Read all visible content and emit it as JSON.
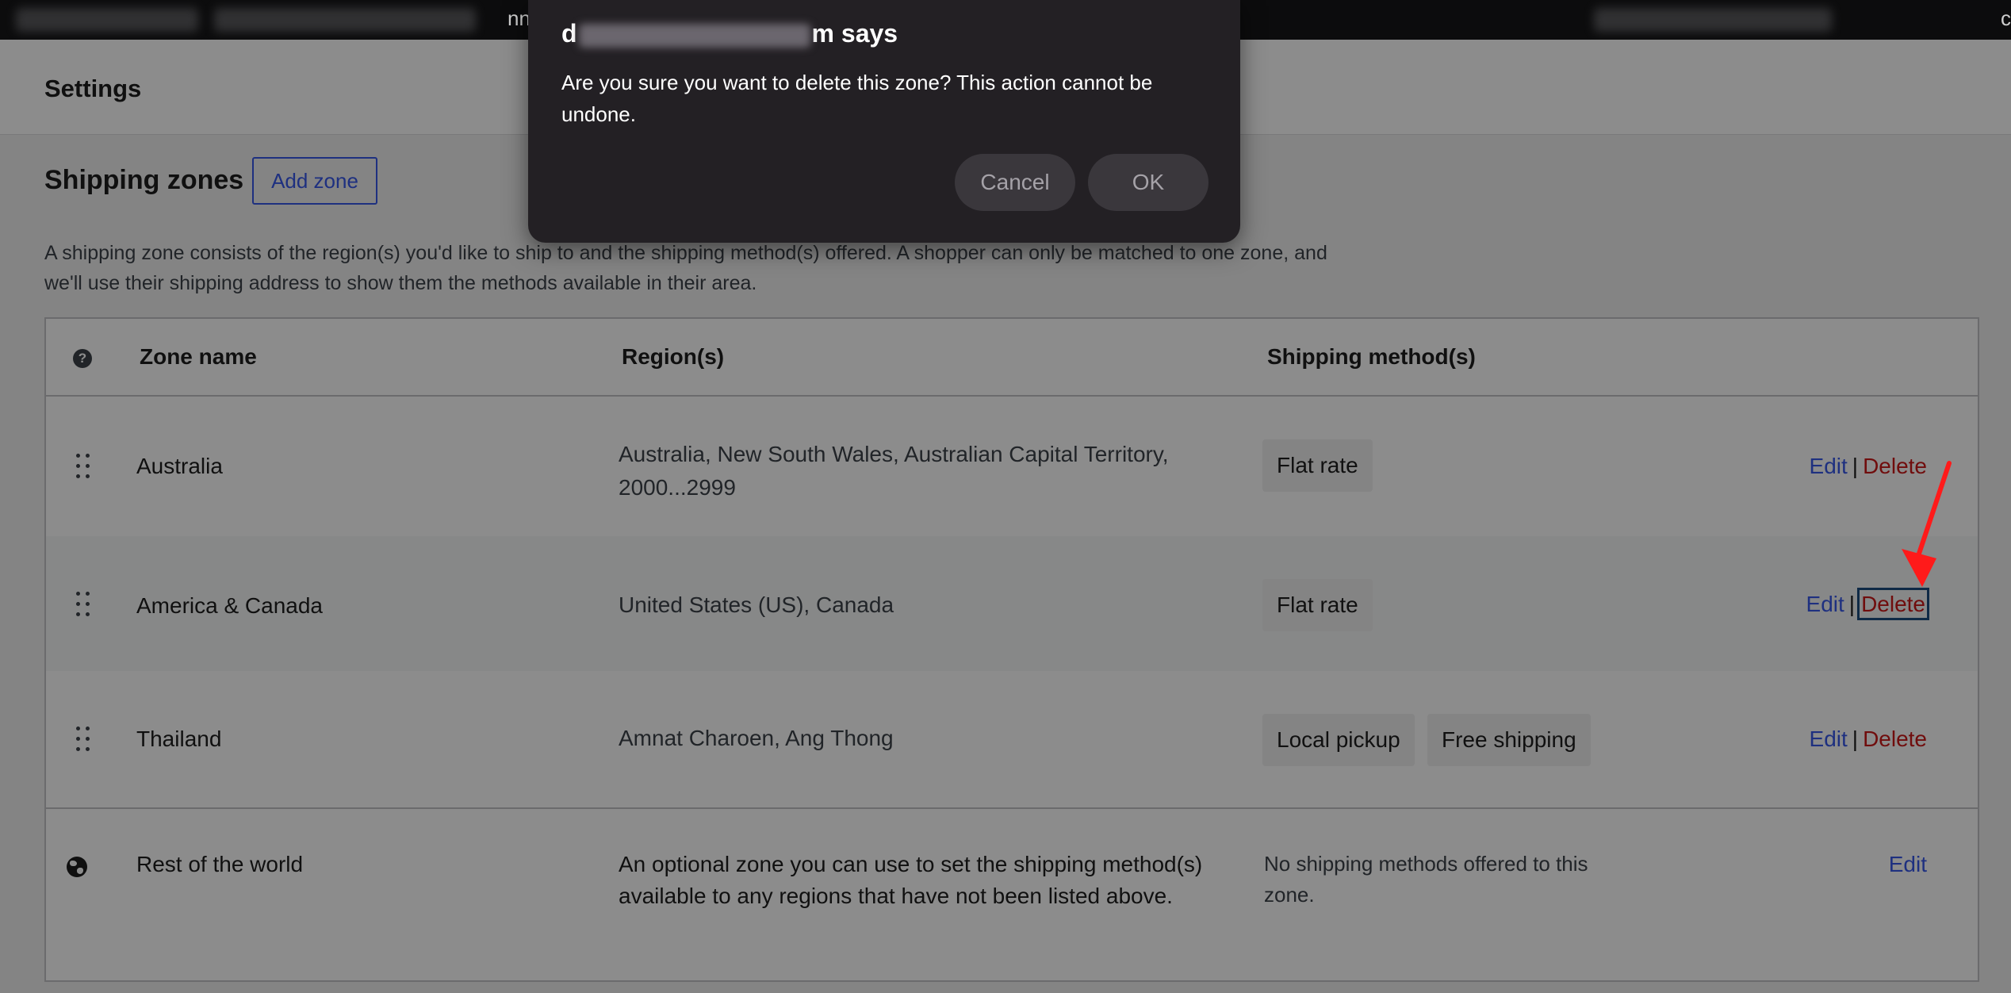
{
  "browser": {
    "left_text_fragment": "nn",
    "right_text_fragment": "c"
  },
  "settings": {
    "title": "Settings"
  },
  "section": {
    "title": "Shipping zones",
    "add_zone_label": "Add zone",
    "description": "A shipping zone consists of the region(s) you'd like to ship to and the shipping method(s) offered. A shopper can only be matched to one zone, and we'll use their shipping address to show them the methods available in their area."
  },
  "table": {
    "headers": {
      "help": "?",
      "zone_name": "Zone name",
      "regions": "Region(s)",
      "methods": "Shipping method(s)"
    },
    "rows": [
      {
        "name": "Australia",
        "regions": "Australia, New South Wales, Australian Capital Territory, 2000...2999",
        "methods": [
          "Flat rate"
        ],
        "edit": "Edit",
        "separator": "|",
        "delete": "Delete"
      },
      {
        "name": "America & Canada",
        "regions": "United States (US), Canada",
        "methods": [
          "Flat rate"
        ],
        "edit": "Edit",
        "separator": "|",
        "delete": "Delete"
      },
      {
        "name": "Thailand",
        "regions": "Amnat Charoen, Ang Thong",
        "methods": [
          "Local pickup",
          "Free shipping"
        ],
        "edit": "Edit",
        "separator": "|",
        "delete": "Delete"
      }
    ],
    "rest_of_world": {
      "name": "Rest of the world",
      "description": "An optional zone you can use to set the shipping method(s) available to any regions that have not been listed above.",
      "methods_text": "No shipping methods offered to this zone.",
      "edit": "Edit"
    }
  },
  "dialog": {
    "title_prefix": "d",
    "title_suffix": "m says",
    "message": "Are you sure you want to delete this zone? This action cannot be undone.",
    "cancel_label": "Cancel",
    "ok_label": "OK"
  },
  "colors": {
    "link": "#3858e9",
    "delete": "#cc1818",
    "dialog_bg": "#232024",
    "annotation_arrow": "#ff1a1a"
  }
}
